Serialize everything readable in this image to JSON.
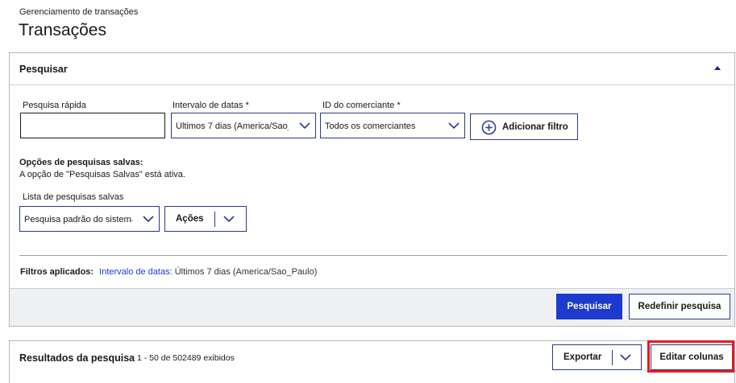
{
  "header": {
    "breadcrumb": "Gerenciamento de transações",
    "title": "Transações"
  },
  "search_panel": {
    "title": "Pesquisar",
    "quick_search": {
      "label": "Pesquisa rápida",
      "value": ""
    },
    "date_range": {
      "label": "Intervalo de datas *",
      "value": "Últimos 7 dias (America/Sao_Paulo)"
    },
    "merchant_id": {
      "label": "ID do comerciante *",
      "value": "Todos os comerciantes"
    },
    "add_filter_label": "Adicionar filtro",
    "saved_searches": {
      "heading": "Opções de pesquisas salvas:",
      "status": "A opção de \"Pesquisas Salvas\" está ativa.",
      "list_label": "Lista de pesquisas salvas",
      "list_value": "Pesquisa padrão do sistema",
      "actions_label": "Ações"
    },
    "applied_filters": {
      "label": "Filtros aplicados:",
      "filter_name": "Intervalo de datas:",
      "filter_value": "Últimos 7 dias (America/Sao_Paulo)"
    },
    "search_button": "Pesquisar",
    "reset_button": "Redefinir pesquisa"
  },
  "results_panel": {
    "title": "Resultados da pesquisa",
    "count_text": "1 - 50 de 502489 exibidos",
    "export_label": "Exportar",
    "edit_columns_label": "Editar colunas"
  },
  "colors": {
    "primary": "#1d3ad0",
    "border_accent": "#2a3a8c",
    "highlight": "#e01b24",
    "footer_bg": "#eef0f2"
  }
}
